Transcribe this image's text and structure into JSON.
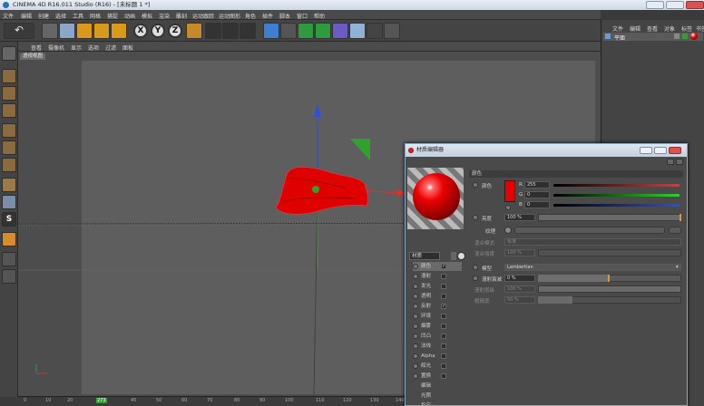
{
  "app": {
    "title": "CINEMA 4D R16.011 Studio (R16) - [未标题 1 *]"
  },
  "menu": [
    "文件",
    "编辑",
    "创建",
    "选择",
    "工具",
    "网格",
    "捕捉",
    "动画",
    "模拟",
    "渲染",
    "雕刻",
    "运动跟踪",
    "运动图形",
    "角色",
    "插件",
    "脚本",
    "窗口",
    "帮助"
  ],
  "toolbar": {
    "axis_labels": [
      "X",
      "Y",
      "Z"
    ]
  },
  "viewport": {
    "menu": [
      "查看",
      "摄像机",
      "显示",
      "选项",
      "过滤",
      "面板"
    ],
    "label": "透视视图"
  },
  "timeline": {
    "ticks": [
      "0",
      "10",
      "20",
      "273",
      "40",
      "50",
      "60",
      "70",
      "80",
      "90",
      "100",
      "110",
      "120",
      "130",
      "140"
    ]
  },
  "right_panel": {
    "menu": [
      "文件",
      "编辑",
      "查看",
      "对象",
      "标签",
      "书签"
    ],
    "row_label": "平面"
  },
  "material_editor": {
    "title": "材质编辑器",
    "material_name": "材质",
    "channels": [
      {
        "label": "颜色",
        "checked": "✓"
      },
      {
        "label": "漫射",
        "checked": ""
      },
      {
        "label": "发光",
        "checked": ""
      },
      {
        "label": "透明",
        "checked": ""
      },
      {
        "label": "反射",
        "checked": "✓"
      },
      {
        "label": "环境",
        "checked": ""
      },
      {
        "label": "烟雾",
        "checked": ""
      },
      {
        "label": "凹凸",
        "checked": ""
      },
      {
        "label": "法线",
        "checked": ""
      },
      {
        "label": "Alpha",
        "checked": ""
      },
      {
        "label": "辉光",
        "checked": ""
      },
      {
        "label": "置换",
        "checked": ""
      }
    ],
    "extra_items": [
      "编辑",
      "光照",
      "指定"
    ],
    "color_section": "颜色",
    "color": {
      "label": "颜色",
      "r_label": "R",
      "r_value": "255",
      "g_label": "G",
      "g_value": "0",
      "b_label": "B",
      "b_value": "0",
      "swatch": "#e80000"
    },
    "brightness": {
      "label": "亮度",
      "value": "100 %"
    },
    "texture": {
      "label": "纹理"
    },
    "mix_mode": {
      "label": "混合模式",
      "value": "标准"
    },
    "mix_strength": {
      "label": "混合强度",
      "value": "100 %"
    },
    "model": {
      "label": "模型",
      "value": "Lambertian"
    },
    "diffuse_falloff": {
      "label": "漫射衰减",
      "value": "0 %"
    },
    "diffuse_level": {
      "label": "漫射层级",
      "value": "100 %"
    },
    "roughness": {
      "label": "粗糙度",
      "value": "50 %"
    }
  },
  "colors": {
    "accent_red": "#e80000",
    "axis_blue": "#2b4fe0",
    "axis_green": "#2fa12f"
  }
}
